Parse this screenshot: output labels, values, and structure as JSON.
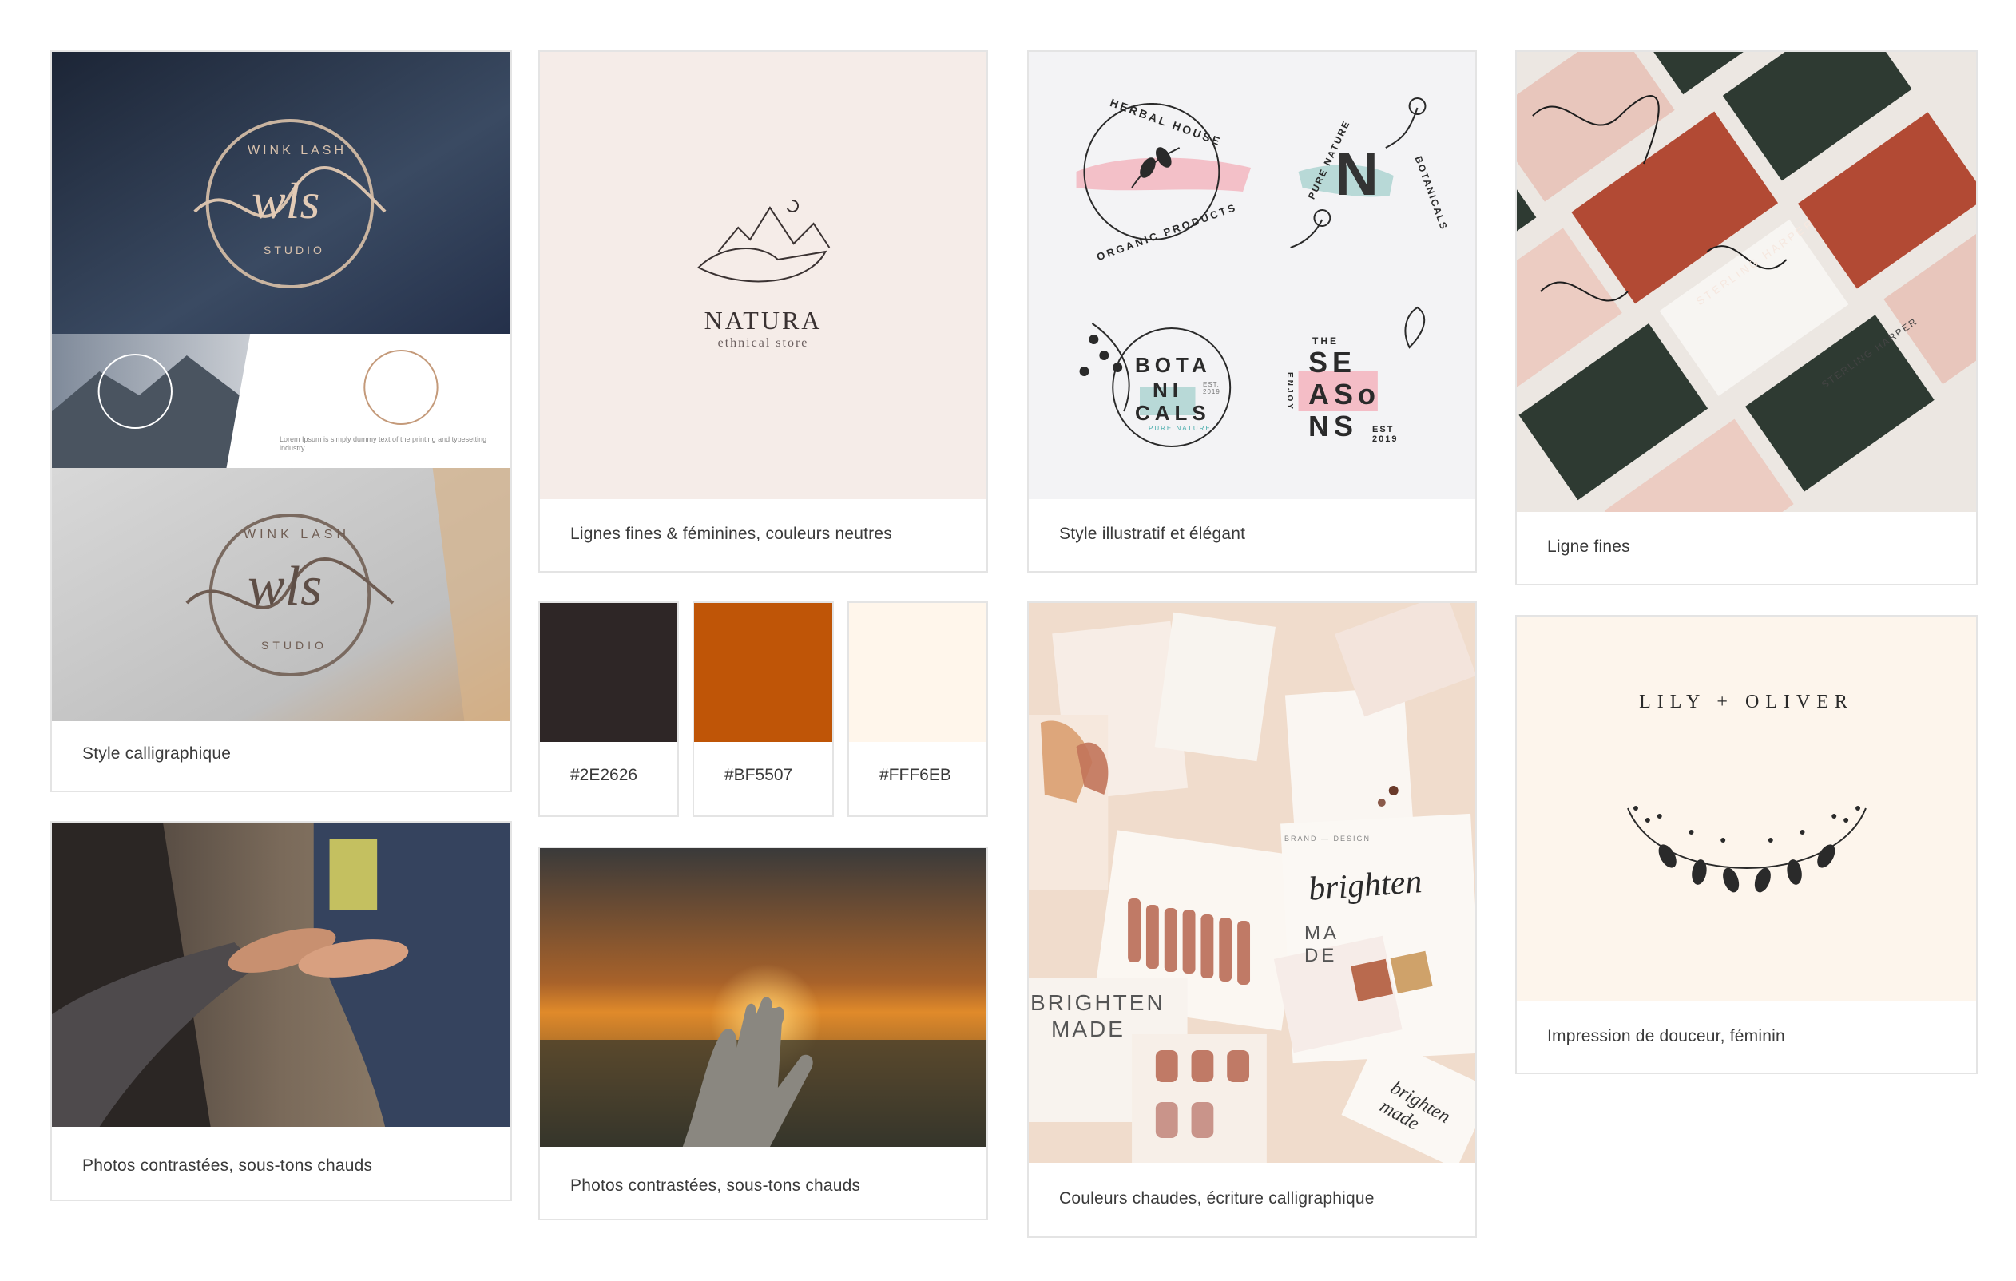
{
  "captions": {
    "calligraphic": "Style calligraphique",
    "photos_left": "Photos contrastées, sous-tons chauds",
    "natura": "Lignes fines & féminines, couleurs neutres",
    "photos_mid": "Photos contrastées, sous-tons chauds",
    "illustrative": "Style illustratif et élégant",
    "warm": "Couleurs chaudes, écriture calligraphique",
    "fine_lines": "Ligne fines",
    "softness": "Impression de douceur, féminin"
  },
  "swatches": [
    {
      "hex": "#2E2626",
      "color": "#2E2626"
    },
    {
      "hex": "#BF5507",
      "color": "#BF5507"
    },
    {
      "hex": "#FFF6EB",
      "color": "#FFF6EB"
    }
  ],
  "logos": {
    "wls_mark": "wls",
    "wls_top": "WINK LASH",
    "wls_bottom": "STUDIO",
    "wls_lorem": "Lorem Ipsum is simply dummy text of the printing and typesetting industry.",
    "natura_name": "NATURA",
    "natura_sub": "ethnical store",
    "herbal_top": "HERBAL HOUSE",
    "herbal_bottom": "ORGANIC PRODUCTS",
    "pure_letter": "N",
    "pure_top": "PURE NATURE",
    "pure_side": "BOTANICALS",
    "bota_1": "BOTA",
    "bota_2": "NI",
    "bota_3": "CALS",
    "bota_est": "EST. 2019",
    "bota_sub": "PURE NATURE",
    "seasons_the": "THE",
    "seasons_1": "SE",
    "seasons_2": "ASo",
    "seasons_3": "NS",
    "seasons_est": "EST 2019",
    "seasons_side": "ENJOY",
    "sterling_1": "STERLING HARPER",
    "sterling_2": "STERLING HARPER",
    "brighten_script": "brighten",
    "brighten_made_1": "MA",
    "brighten_made_2": "DE",
    "brighten_big_1": "BRIGHTEN",
    "brighten_big_2": "MADE",
    "brighten_script2": "brighten made",
    "brand_design": "BRAND — DESIGN",
    "lily_oliver": "LILY + OLIVER"
  }
}
